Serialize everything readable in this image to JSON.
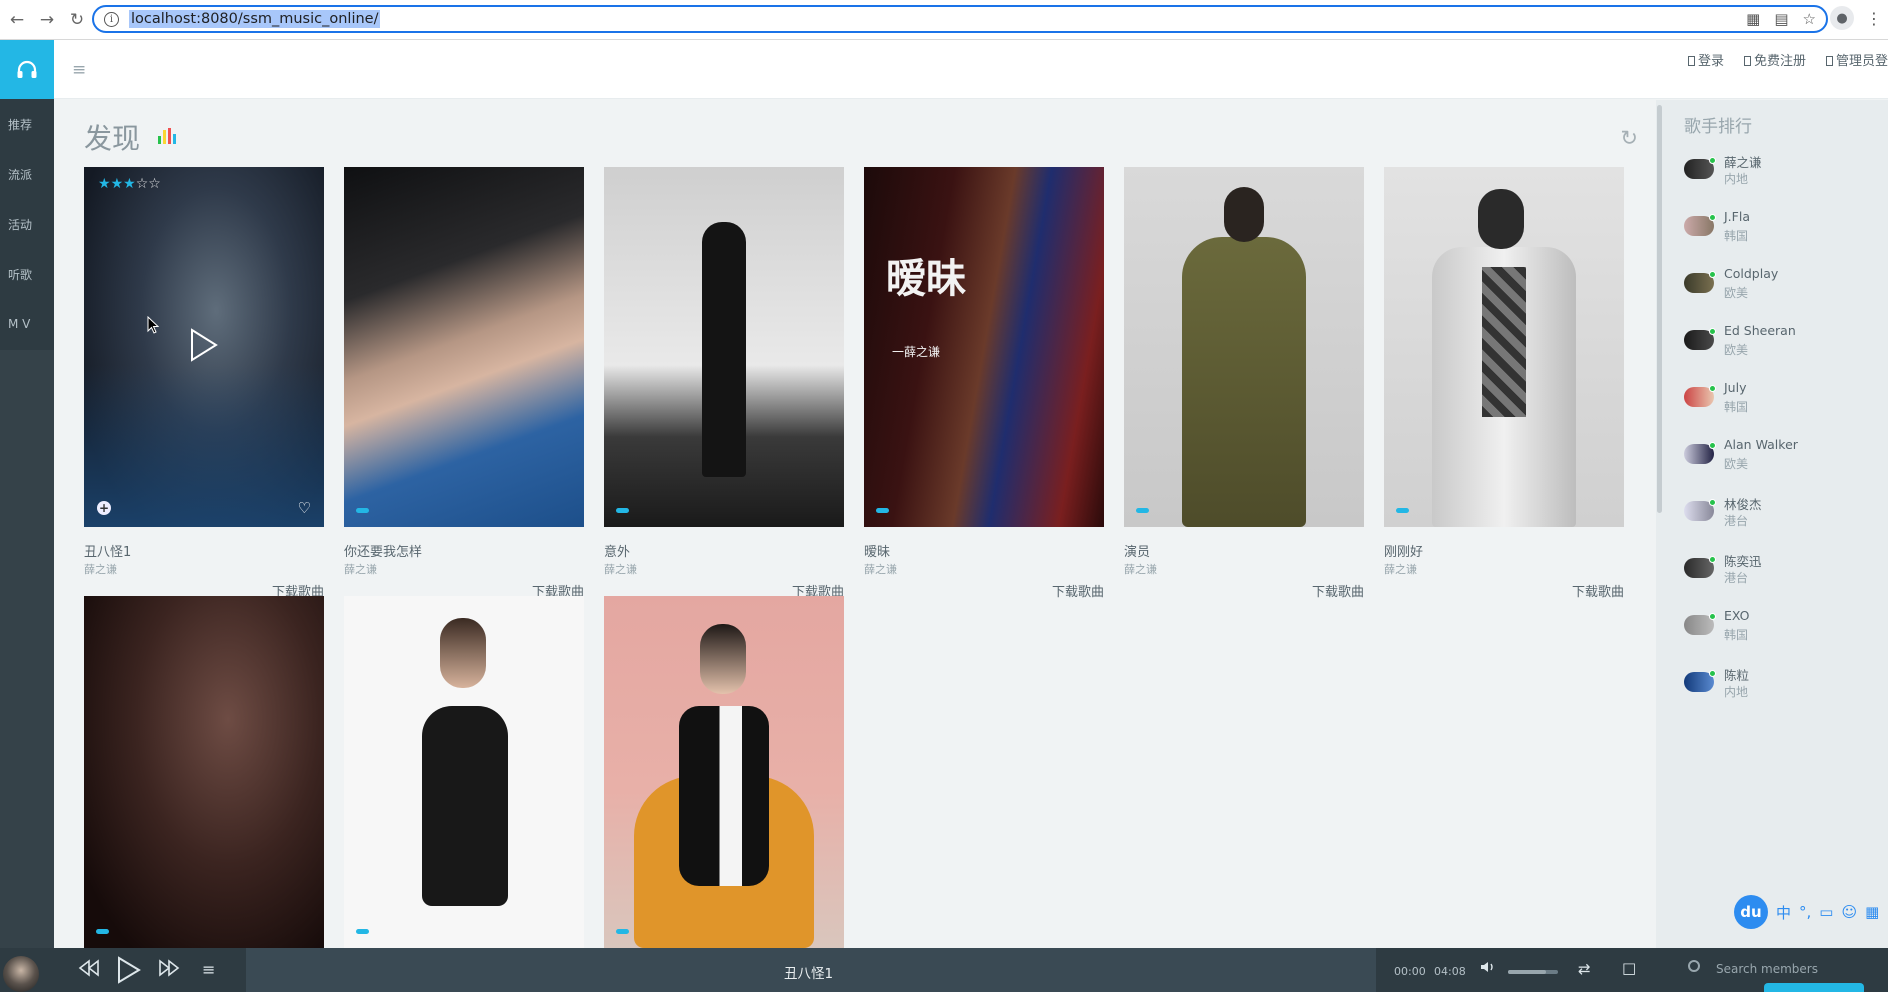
{
  "browser": {
    "url": "localhost:8080/ssm_music_online/"
  },
  "header": {
    "links": [
      "登录",
      "免费注册",
      "管理员登"
    ]
  },
  "nav": {
    "items": [
      "推荐",
      "流派",
      "活动",
      "听歌",
      "M V"
    ]
  },
  "main": {
    "title": "发现",
    "rating": 3,
    "rating_max": 5,
    "download_label": "下载歌曲",
    "songs": [
      {
        "name": "丑八怪1",
        "singer": "薛之谦"
      },
      {
        "name": "你还要我怎样",
        "singer": "薛之谦"
      },
      {
        "name": "意外",
        "singer": "薛之谦"
      },
      {
        "name": "暧昧",
        "singer": "薛之谦"
      },
      {
        "name": "演员",
        "singer": "薛之谦"
      },
      {
        "name": "刚刚好",
        "singer": "薛之谦"
      }
    ],
    "cover_text": [
      "暧昧",
      "一薛之谦"
    ]
  },
  "aside": {
    "title": "歌手排行",
    "artists": [
      {
        "name": "薛之谦",
        "region": "内地"
      },
      {
        "name": "J.Fla",
        "region": "韩国"
      },
      {
        "name": "Coldplay",
        "region": "欧美"
      },
      {
        "name": "Ed Sheeran",
        "region": "欧美"
      },
      {
        "name": "July",
        "region": "韩国"
      },
      {
        "name": "Alan Walker",
        "region": "欧美"
      },
      {
        "name": "林俊杰",
        "region": "港台"
      },
      {
        "name": "陈奕迅",
        "region": "港台"
      },
      {
        "name": "EXO",
        "region": "韩国"
      },
      {
        "name": "陈粒",
        "region": "内地"
      }
    ]
  },
  "widget": {
    "logo": "du",
    "lang": "中"
  },
  "player": {
    "title": "丑八怪1",
    "current_time": "00:00",
    "duration": "04:08",
    "volume": 0.75,
    "search_placeholder": "Search members"
  },
  "colors": {
    "accent": "#23b7e5",
    "sidebar": "#2e3b42",
    "online": "#27c24c"
  }
}
